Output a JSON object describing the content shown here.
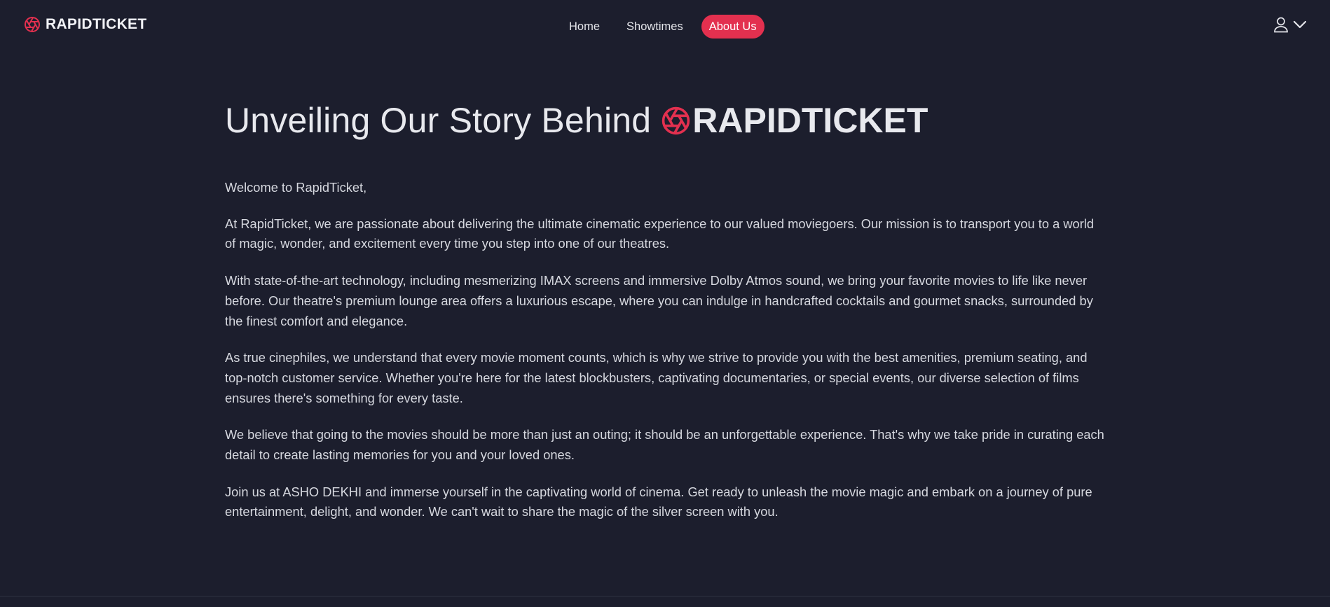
{
  "header": {
    "brand": "RAPIDTICKET",
    "nav": [
      {
        "label": "Home",
        "active": false
      },
      {
        "label": "Showtimes",
        "active": false
      },
      {
        "label": "About Us",
        "active": true
      }
    ],
    "icons": {
      "brand": "aperture-icon",
      "user": "user-icon",
      "menu": "chevron-down-icon"
    }
  },
  "main": {
    "heading_prefix": "Unveiling Our Story Behind",
    "heading_brand": "RAPIDTICKET",
    "greeting": "Welcome to RapidTicket,",
    "paragraphs": [
      "At RapidTicket, we are passionate about delivering the ultimate cinematic experience to our valued moviegoers. Our mission is to transport you to a world of magic, wonder, and excitement every time you step into one of our theatres.",
      "With state-of-the-art technology, including mesmerizing IMAX screens and immersive Dolby Atmos sound, we bring your favorite movies to life like never before. Our theatre's premium lounge area offers a luxurious escape, where you can indulge in handcrafted cocktails and gourmet snacks, surrounded by the finest comfort and elegance.",
      "As true cinephiles, we understand that every movie moment counts, which is why we strive to provide you with the best amenities, premium seating, and top-notch customer service. Whether you're here for the latest blockbusters, captivating documentaries, or special events, our diverse selection of films ensures there's something for every taste.",
      "We believe that going to the movies should be more than just an outing; it should be an unforgettable experience. That's why we take pride in curating each detail to create lasting memories for you and your loved ones.",
      "Join us at ASHO DEKHI and immerse yourself in the captivating world of cinema. Get ready to unleash the movie magic and embark on a journey of pure entertainment, delight, and wonder. We can't wait to share the magic of the silver screen with you."
    ]
  },
  "colors": {
    "background": "#1c1e2d",
    "accent": "#e3304f",
    "text": "#e4e5ea"
  }
}
